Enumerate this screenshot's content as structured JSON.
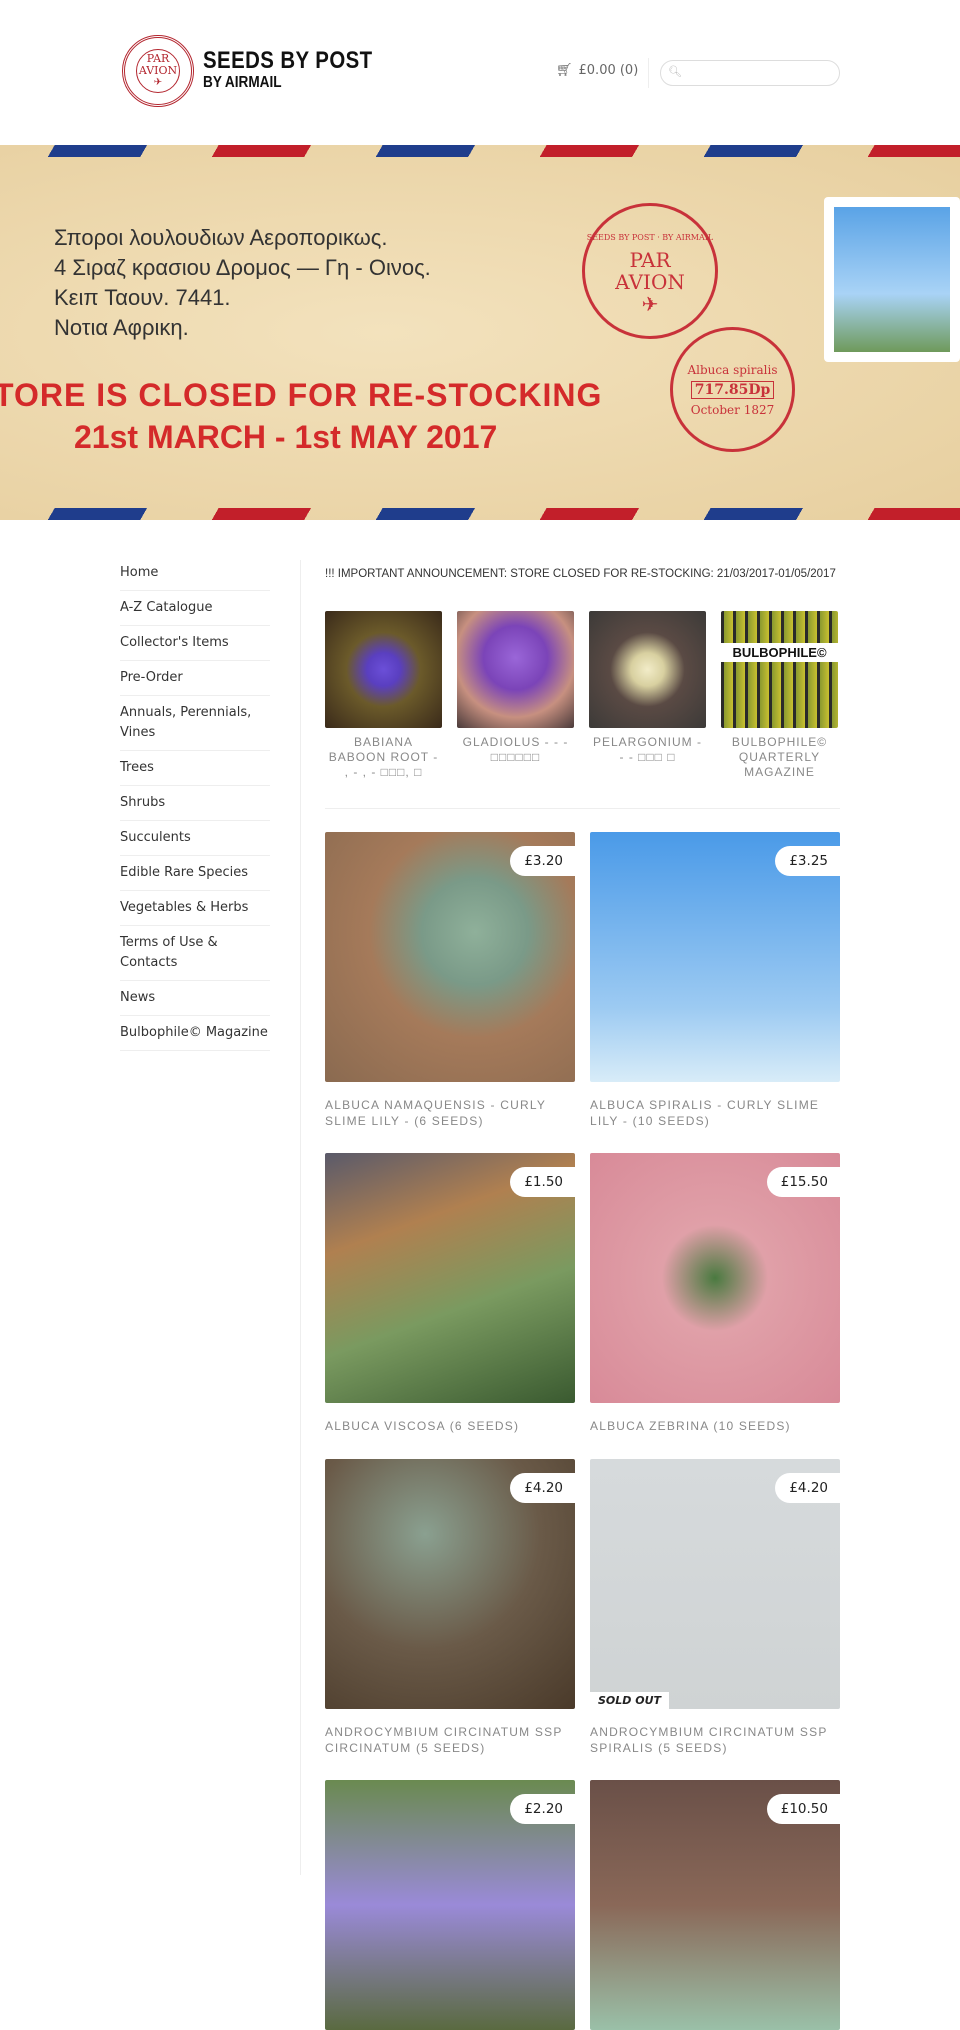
{
  "header": {
    "logo": {
      "line1": "PAR",
      "line2": "AVION"
    },
    "brand_line1": "SEEDS BY POST",
    "brand_line2": "BY AIRMAIL",
    "cart_label": "£0.00 (0)",
    "search": {
      "value": "",
      "placeholder": ""
    }
  },
  "banner": {
    "address": [
      "Σποροι λουλουδιων Αεροπορικως.",
      "4 Σιραζ κρασιου Δρομος — Γη - Οινος.",
      "Κειπ Ταουν. 7441.",
      "Νοτια Αφρικη."
    ],
    "closed_line1": "TORE  IS  CLOSED  FOR  RE-STOCKING",
    "closed_line2": "21st MARCH  -  1st MAY  2017",
    "stamp1": {
      "ring": "SEEDS BY POST · BY AIRMAIL",
      "line1": "PAR",
      "line2": "AVION"
    },
    "stamp2": {
      "top": "Albuca spiralis",
      "value": "717.85Dp",
      "bottom": "October 1827"
    },
    "colors": {
      "red": "#c21f2a",
      "blue": "#1f3d8c"
    }
  },
  "sidebar": {
    "items": [
      {
        "label": "Home"
      },
      {
        "label": "A-Z Catalogue"
      },
      {
        "label": "Collector's Items"
      },
      {
        "label": "Pre-Order"
      },
      {
        "label": "Annuals, Perennials, Vines"
      },
      {
        "label": "Trees"
      },
      {
        "label": "Shrubs"
      },
      {
        "label": "Succulents"
      },
      {
        "label": "Edible Rare Species"
      },
      {
        "label": "Vegetables & Herbs"
      },
      {
        "label": "Terms of Use & Contacts"
      },
      {
        "label": "News"
      },
      {
        "label": "Bulbophile© Magazine"
      }
    ]
  },
  "main": {
    "announcement": "!!! IMPORTANT ANNOUNCEMENT: STORE CLOSED FOR RE-STOCKING: 21/03/2017-01/05/2017",
    "featured": [
      {
        "caption": "BABIANA BABOON ROOT - , - , - □□□, □",
        "overlay": ""
      },
      {
        "caption": "GLADIOLUS - - - □□□□□□",
        "overlay": ""
      },
      {
        "caption": "PELARGONIUM - - - □□□ □",
        "overlay": ""
      },
      {
        "caption": "BULBOPHILE© QUARTERLY MAGAZINE",
        "overlay": "BULBOPHILE©"
      }
    ],
    "products": [
      {
        "title": "ALBUCA NAMAQUENSIS - CURLY SLIME LILY - (6 SEEDS)",
        "price": "£3.20"
      },
      {
        "title": "ALBUCA SPIRALIS - CURLY SLIME LILY - (10 SEEDS)",
        "price": "£3.25"
      },
      {
        "title": "ALBUCA VISCOSA (6 SEEDS)",
        "price": "£1.50"
      },
      {
        "title": "ALBUCA ZEBRINA (10 SEEDS)",
        "price": "£15.50"
      },
      {
        "title": "ANDROCYMBIUM CIRCINATUM SSP CIRCINATUM (5 SEEDS)",
        "price": "£4.20"
      },
      {
        "title": "ANDROCYMBIUM CIRCINATUM SSP SPIRALIS (5 SEEDS)",
        "price": "£4.20",
        "badge": "SOLD OUT"
      },
      {
        "title": "",
        "price": "£2.20"
      },
      {
        "title": "",
        "price": "£10.50"
      }
    ]
  }
}
